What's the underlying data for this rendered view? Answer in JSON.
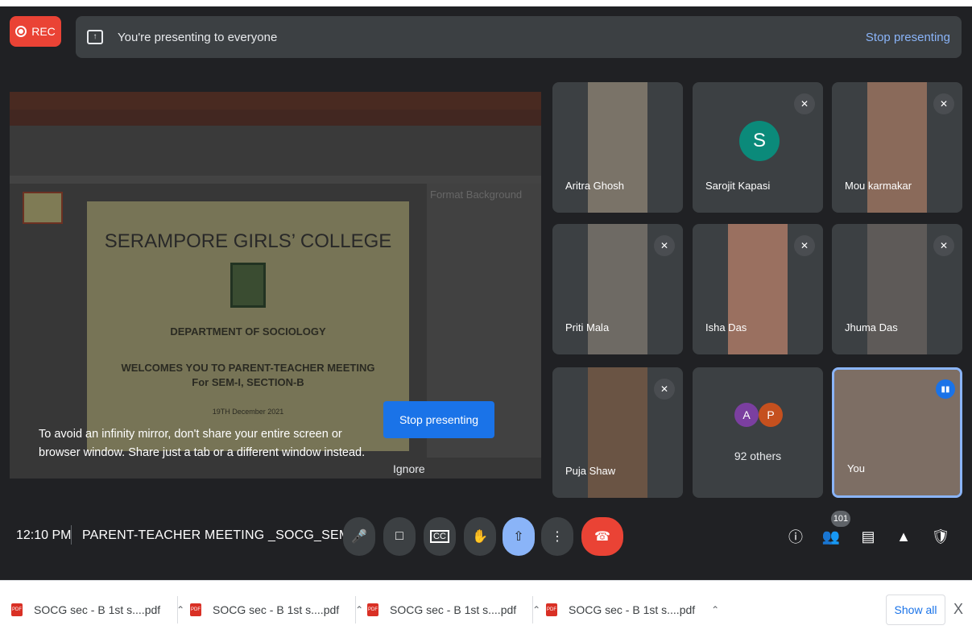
{
  "recording": {
    "label": "REC"
  },
  "banner": {
    "message": "You're presenting to everyone",
    "stop_label": "Stop presenting"
  },
  "slide": {
    "college": "SERAMPORE GIRLS’ COLLEGE",
    "department": "DEPARTMENT OF SOCIOLOGY",
    "welcome": "WELCOMES YOU TO PARENT-TEACHER MEETING",
    "section": "For SEM-I, SECTION-B",
    "date": "19TH December 2021",
    "pane_title": "Format Background"
  },
  "presenting_overlay": {
    "warning": "To avoid an infinity mirror, don't share your entire screen or browser window. Share just a tab or a different window instead.",
    "stop_label": "Stop presenting",
    "ignore_label": "Ignore"
  },
  "participants": [
    {
      "name": "Aritra Ghosh"
    },
    {
      "name": "Sarojit Kapasi",
      "initial": "S"
    },
    {
      "name": "Mou karmakar"
    },
    {
      "name": "Priti Mala"
    },
    {
      "name": "Isha Das"
    },
    {
      "name": "Jhuma Das"
    },
    {
      "name": "Puja Shaw"
    },
    {
      "name": "92 others",
      "initials": [
        "A",
        "P"
      ]
    },
    {
      "name": "You"
    }
  ],
  "meeting": {
    "time": "12:10 PM",
    "title": "PARENT-TEACHER MEETING _SOCG_SEM...",
    "people_count": "101"
  },
  "downloads": {
    "items": [
      "SOCG sec - B 1st s....pdf",
      "SOCG sec - B 1st s....pdf",
      "SOCG sec - B 1st s....pdf",
      "SOCG sec - B 1st s....pdf"
    ],
    "show_all": "Show all",
    "close": "X"
  },
  "colors": {
    "accent": "#8ab4f8",
    "end_call": "#ea4335",
    "background": "#202124"
  }
}
